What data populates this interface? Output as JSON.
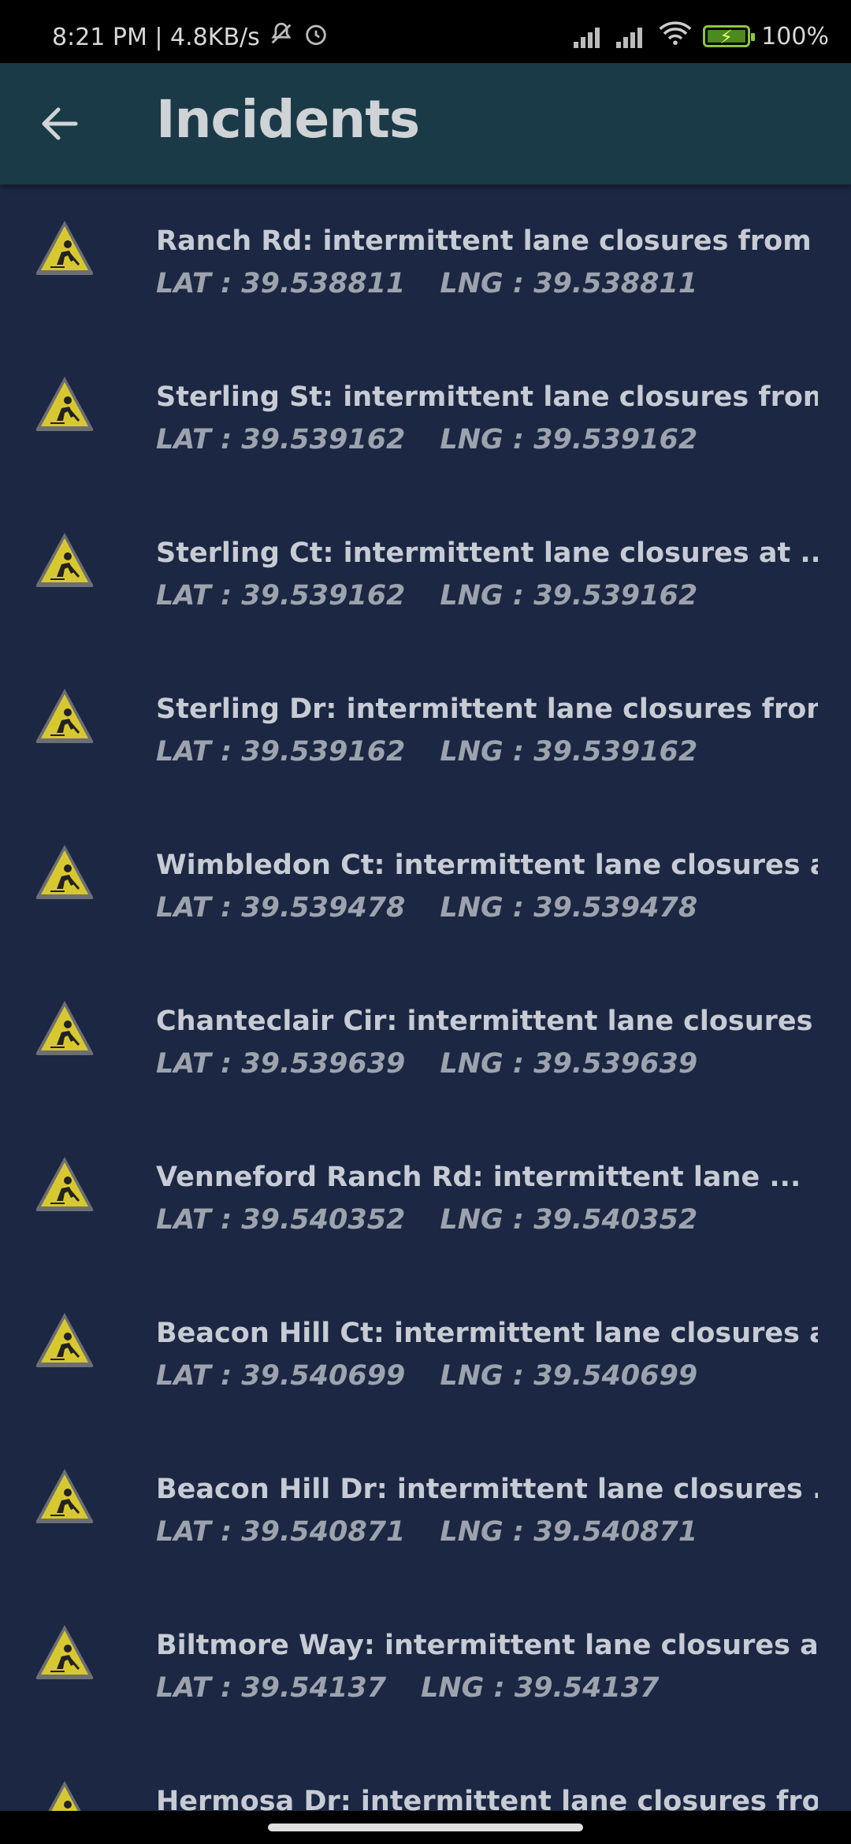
{
  "status_bar": {
    "time_speed": "8:21 PM | 4.8KB/s",
    "battery": "100%"
  },
  "header": {
    "title": "Incidents",
    "back_icon": "arrow-left-icon"
  },
  "incidents": [
    {
      "title": "Ranch Rd: intermittent lane closures from ...",
      "lat": "LAT : 39.538811",
      "lng": "LNG : 39.538811"
    },
    {
      "title": "Sterling St: intermittent lane closures from...",
      "lat": "LAT : 39.539162",
      "lng": "LNG : 39.539162"
    },
    {
      "title": "Sterling Ct: intermittent lane closures at ...",
      "lat": "LAT : 39.539162",
      "lng": "LNG : 39.539162"
    },
    {
      "title": "Sterling Dr: intermittent lane closures from...",
      "lat": "LAT : 39.539162",
      "lng": "LNG : 39.539162"
    },
    {
      "title": "Wimbledon Ct: intermittent lane closures a...",
      "lat": "LAT : 39.539478",
      "lng": "LNG : 39.539478"
    },
    {
      "title": "Chanteclair Cir: intermittent lane closures ...",
      "lat": "LAT : 39.539639",
      "lng": "LNG : 39.539639"
    },
    {
      "title": "Venneford Ranch Rd: intermittent lane ...",
      "lat": "LAT : 39.540352",
      "lng": "LNG : 39.540352"
    },
    {
      "title": "Beacon Hill Ct: intermittent lane closures a...",
      "lat": "LAT : 39.540699",
      "lng": "LNG : 39.540699"
    },
    {
      "title": "Beacon Hill Dr: intermittent lane closures ...",
      "lat": "LAT : 39.540871",
      "lng": "LNG : 39.540871"
    },
    {
      "title": "Biltmore Way: intermittent lane closures at...",
      "lat": "LAT : 39.54137",
      "lng": "LNG : 39.54137"
    },
    {
      "title": "Hermosa Dr: intermittent lane closures fro...",
      "lat": "",
      "lng": ""
    }
  ],
  "icons": {
    "incident_icon": "construction-warning-icon"
  }
}
